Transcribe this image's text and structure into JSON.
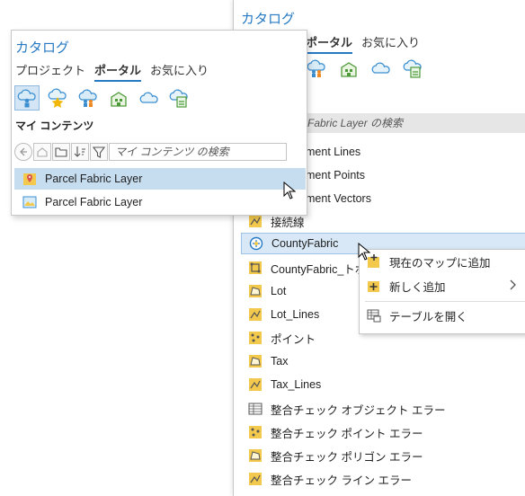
{
  "back_panel": {
    "title": "カタログ",
    "tabs": [
      {
        "label": "ポータル"
      },
      {
        "label": "お気に入り"
      }
    ],
    "search_hint": "Fabric Layer の検索",
    "items": [
      {
        "label": "ment Lines",
        "icon": "line-feature-icon"
      },
      {
        "label": "ment Points",
        "icon": "point-feature-icon"
      },
      {
        "label": "ment Vectors",
        "icon": "vector-feature-icon"
      },
      {
        "label": "接続線",
        "icon": "line-feature-icon"
      },
      {
        "label": "CountyFabric",
        "icon": "parcel-fabric-icon"
      },
      {
        "label": "CountyFabric_トポ",
        "icon": "topology-icon"
      },
      {
        "label": "Lot",
        "icon": "polygon-feature-icon"
      },
      {
        "label": "Lot_Lines",
        "icon": "line-feature-icon"
      },
      {
        "label": "ポイント",
        "icon": "point-feature-icon"
      },
      {
        "label": "Tax",
        "icon": "polygon-feature-icon"
      },
      {
        "label": "Tax_Lines",
        "icon": "line-feature-icon"
      },
      {
        "label": "整合チェック オブジェクト エラー",
        "icon": "table-icon"
      },
      {
        "label": "整合チェック ポイント エラー",
        "icon": "point-feature-icon"
      },
      {
        "label": "整合チェック ポリゴン エラー",
        "icon": "polygon-feature-icon"
      },
      {
        "label": "整合チェック ライン エラー",
        "icon": "line-feature-icon"
      }
    ]
  },
  "front_panel": {
    "title": "カタログ",
    "tabs": [
      {
        "label": "プロジェクト"
      },
      {
        "label": "ポータル"
      },
      {
        "label": "お気に入り"
      }
    ],
    "section": "マイ コンテンツ",
    "search_placeholder": "マイ コンテンツ の検索",
    "items": [
      {
        "label": "Parcel Fabric Layer",
        "icon": "parcel-layer-package-icon"
      },
      {
        "label": "Parcel Fabric Layer",
        "icon": "map-image-layer-icon"
      }
    ]
  },
  "context_menu": {
    "items": [
      {
        "label": "現在のマップに追加",
        "icon": "add-to-map-icon"
      },
      {
        "label": "新しく追加",
        "icon": "add-new-icon",
        "submenu": true
      },
      {
        "label": "テーブルを開く",
        "icon": "open-table-icon"
      }
    ]
  },
  "colors": {
    "accent": "#2679c3",
    "selection": "#c6dcef",
    "feature_yellow": "#f2c94c"
  }
}
